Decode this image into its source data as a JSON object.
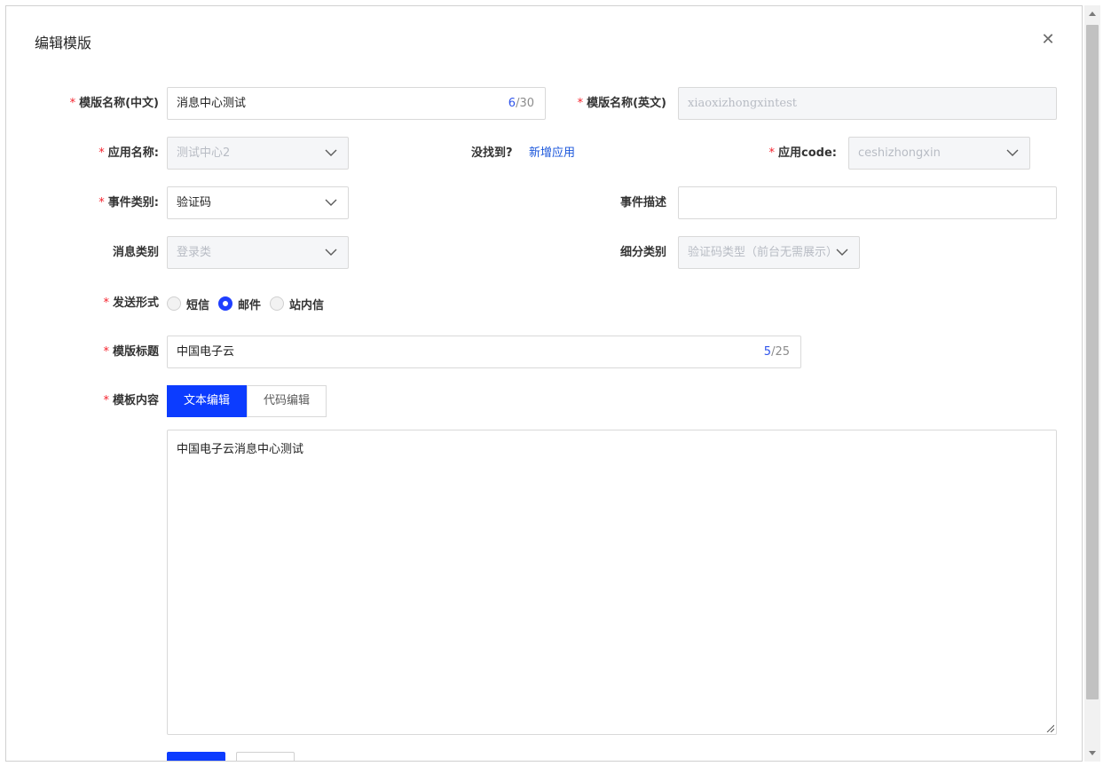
{
  "dialog": {
    "title": "编辑模版"
  },
  "fields": {
    "name_cn": {
      "label": "模版名称(中文)",
      "value": "消息中心测试",
      "count_current": "6",
      "count_max": "/30"
    },
    "name_en": {
      "label": "模版名称(英文)",
      "value": "xiaoxizhongxintest"
    },
    "app_name": {
      "label": "应用名称:",
      "value": "测试中心2"
    },
    "not_found": {
      "text": "没找到?",
      "link": "新增应用"
    },
    "app_code": {
      "label": "应用code:",
      "value": "ceshizhongxin"
    },
    "event_type": {
      "label": "事件类别:",
      "value": "验证码"
    },
    "event_desc": {
      "label": "事件描述",
      "value": ""
    },
    "msg_type": {
      "label": "消息类别",
      "value": "登录类"
    },
    "sub_type": {
      "label": "细分类别",
      "value": "验证码类型（前台无需展示）"
    },
    "send_form": {
      "label": "发送形式",
      "options": [
        "短信",
        "邮件",
        "站内信"
      ],
      "selected": "邮件"
    },
    "subject": {
      "label": "模版标题",
      "value": "中国电子云",
      "count_current": "5",
      "count_max": "/25"
    },
    "content": {
      "label": "模板内容",
      "tabs": [
        "文本编辑",
        "代码编辑"
      ],
      "active_tab": "文本编辑",
      "value": "中国电子云消息中心测试"
    }
  },
  "icons": {
    "close": "close-icon",
    "select": "chevron-down-icon",
    "resize": "resize-grip-icon"
  },
  "colors": {
    "primary": "#0c3cff",
    "required": "#f5222d",
    "link": "#1a56db",
    "counter": "#2f54eb"
  }
}
